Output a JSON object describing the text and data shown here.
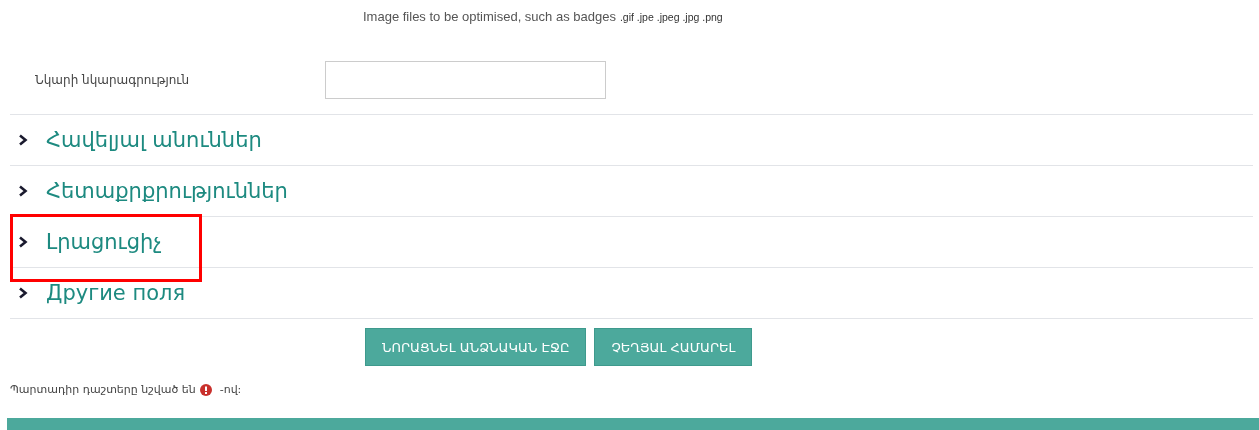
{
  "file_types_note": {
    "text": "Image files to be optimised, such as badges",
    "types": ".gif .jpe .jpeg .jpg .png"
  },
  "image_description": {
    "label": "Նկարի նկարագրություն"
  },
  "sections": [
    {
      "title": "Հավելյալ անուններ",
      "expanded": false,
      "highlighted": false
    },
    {
      "title": "Հետաքրքրություններ",
      "expanded": false,
      "highlighted": false
    },
    {
      "title": "Լրացուցիչ",
      "expanded": false,
      "highlighted": true
    },
    {
      "title": "Другие поля",
      "expanded": false,
      "highlighted": false
    }
  ],
  "buttons": [
    {
      "label": "ՆՈՐԱՑՆԵԼ ԱՆՁՆԱԿԱՆ ԷՋԸ"
    },
    {
      "label": "ՉԵՂՅԱԼ ՀԱՄԱՐԵԼ"
    }
  ],
  "required_note": {
    "before": "Պարտադիր դաշտերը նշված են",
    "after": "-ով:"
  }
}
